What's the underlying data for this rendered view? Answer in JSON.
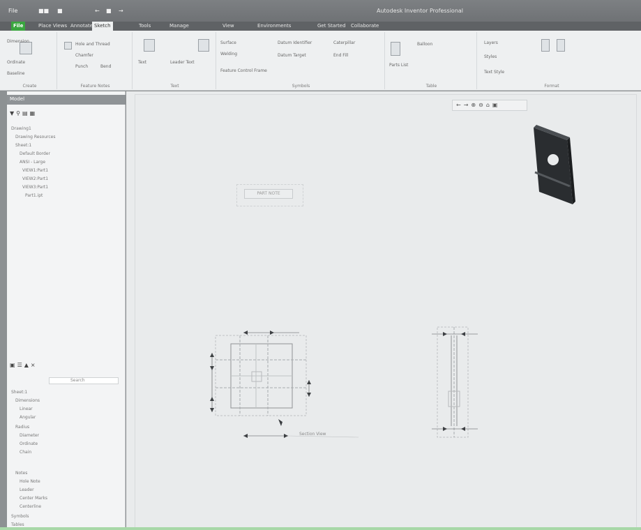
{
  "titlebar": {
    "quick_access": [
      "File",
      "■■",
      "■",
      "←",
      "■",
      "→"
    ],
    "app_title": "Autodesk Inventor Professional"
  },
  "ribbon": {
    "tabs": [
      {
        "label": "File"
      },
      {
        "label": "Place Views"
      },
      {
        "label": "Annotate"
      },
      {
        "label": "Sketch"
      },
      {
        "label": "Tools"
      },
      {
        "label": "Manage"
      },
      {
        "label": "View"
      },
      {
        "label": "Environments"
      },
      {
        "label": "Get Started"
      },
      {
        "label": "Collaborate"
      }
    ],
    "active_tab_index": 3,
    "groups": [
      {
        "label": "Create",
        "buttons": [
          "Dimension",
          "Ordinate",
          "Baseline"
        ]
      },
      {
        "label": "Feature Notes",
        "buttons": [
          "Hole and Thread",
          "Chamfer",
          "Punch",
          "Bend"
        ]
      },
      {
        "label": "Text",
        "buttons": [
          "Text",
          "Leader Text"
        ]
      },
      {
        "label": "Symbols",
        "buttons": [
          "Surface",
          "Welding",
          "Feature Control Frame",
          "Datum Identifier",
          "Datum Target",
          "Caterpillar",
          "End Fill"
        ]
      },
      {
        "label": "Table",
        "buttons": [
          "Parts List",
          "Balloon"
        ]
      },
      {
        "label": "Format",
        "buttons": [
          "Layers",
          "Styles",
          "Text Style"
        ]
      }
    ]
  },
  "browser": {
    "title": "Model",
    "toolbar_icons": [
      "filter-icon",
      "search-icon",
      "expand-icon",
      "collapse-icon"
    ],
    "tree": [
      "Drawing1",
      "Drawing Resources",
      "Sheet:1",
      "Default Border",
      "ANSI - Large",
      "VIEW1:Part1",
      "VIEW2:Part1",
      "VIEW3:Part1",
      "Part1.ipt"
    ]
  },
  "properties_panel": {
    "toolbar_icons": [
      "grid-icon",
      "list-icon",
      "pin-icon",
      "close-icon"
    ],
    "filter_label": "Search",
    "items": [
      "Sheet:1",
      "Dimensions",
      "Linear",
      "Angular",
      "Radius",
      "Diameter",
      "Ordinate",
      "Chain",
      "Notes",
      "Hole Note",
      "Leader",
      "Center Marks",
      "Centerline",
      "Symbols",
      "Tables"
    ]
  },
  "drawing": {
    "view_toolbar_icons": [
      "←",
      "→",
      "⊕",
      "⊖",
      "⌂",
      "▣"
    ],
    "note_text": "PART NOTE",
    "front_view_label": "Section View",
    "colors": {
      "part": "#2a2d30",
      "geometry": "#8f9294",
      "dimension": "#4a4d50",
      "sheet": "#e9ebec"
    }
  }
}
